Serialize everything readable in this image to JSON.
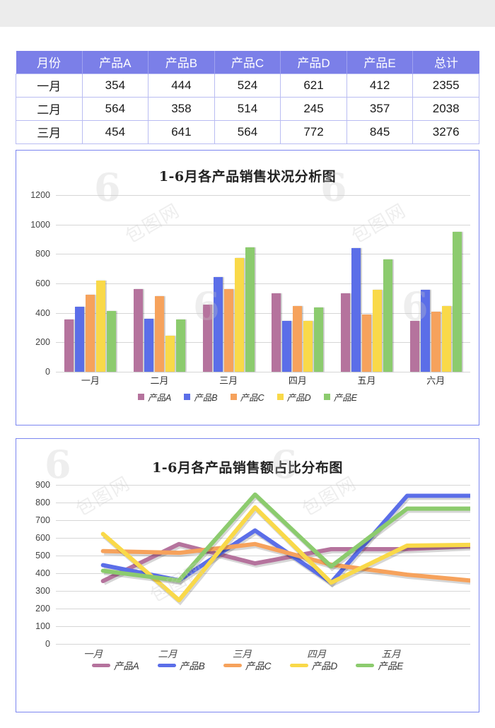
{
  "table": {
    "headers": [
      "月份",
      "产品A",
      "产品B",
      "产品C",
      "产品D",
      "产品E",
      "总计"
    ],
    "rows": [
      {
        "month": "一月",
        "a": "354",
        "b": "444",
        "c": "524",
        "d": "621",
        "e": "412",
        "total": "2355"
      },
      {
        "month": "二月",
        "a": "564",
        "b": "358",
        "c": "514",
        "d": "245",
        "e": "357",
        "total": "2038"
      },
      {
        "month": "三月",
        "a": "454",
        "b": "641",
        "c": "564",
        "d": "772",
        "e": "845",
        "total": "3276"
      }
    ]
  },
  "colors": {
    "product_a": "#b5739d",
    "product_b": "#5b6ee8",
    "product_c": "#f6a25c",
    "product_d": "#f9d949",
    "product_e": "#8ccb6e",
    "header_bg": "#7b7fe8",
    "panel_border": "#7b86f0",
    "gridline": "#d6d6d6"
  },
  "bar_chart": {
    "title": "1-6月各产品销售状况分析图",
    "legend": [
      {
        "label": "产品A",
        "color": "#b5739d"
      },
      {
        "label": "产品B",
        "color": "#5b6ee8"
      },
      {
        "label": "产品C",
        "color": "#f6a25c"
      },
      {
        "label": "产品D",
        "color": "#f9d949"
      },
      {
        "label": "产品E",
        "color": "#8ccb6e"
      }
    ]
  },
  "line_chart": {
    "title": "1-6月各产品销售额占比分布图",
    "legend": [
      {
        "label": "产品A",
        "color": "#b5739d"
      },
      {
        "label": "产品B",
        "color": "#5b6ee8"
      },
      {
        "label": "产品C",
        "color": "#f6a25c"
      },
      {
        "label": "产品D",
        "color": "#f9d949"
      },
      {
        "label": "产品E",
        "color": "#8ccb6e"
      }
    ]
  },
  "chart_data": [
    {
      "type": "bar",
      "title": "1-6月各产品销售状况分析图",
      "xlabel": "",
      "ylabel": "",
      "categories": [
        "一月",
        "二月",
        "三月",
        "四月",
        "五月",
        "六月"
      ],
      "ylim": [
        0,
        1200
      ],
      "yticks": [
        0,
        200,
        400,
        600,
        800,
        1000,
        1200
      ],
      "grid": true,
      "legend_position": "bottom",
      "series": [
        {
          "name": "产品A",
          "color": "#b5739d",
          "values": [
            354,
            564,
            454,
            535,
            535,
            345
          ]
        },
        {
          "name": "产品B",
          "color": "#5b6ee8",
          "values": [
            444,
            358,
            641,
            345,
            838,
            555
          ]
        },
        {
          "name": "产品C",
          "color": "#f6a25c",
          "values": [
            524,
            514,
            564,
            447,
            390,
            410
          ]
        },
        {
          "name": "产品D",
          "color": "#f9d949",
          "values": [
            621,
            245,
            772,
            345,
            555,
            445
          ]
        },
        {
          "name": "产品E",
          "color": "#8ccb6e",
          "values": [
            412,
            357,
            845,
            437,
            765,
            950
          ]
        }
      ]
    },
    {
      "type": "line",
      "title": "1-6月各产品销售额占比分布图",
      "xlabel": "",
      "ylabel": "",
      "categories": [
        "一月",
        "二月",
        "三月",
        "四月",
        "五月"
      ],
      "ylim": [
        0,
        900
      ],
      "yticks": [
        0,
        100,
        200,
        300,
        400,
        500,
        600,
        700,
        800,
        900
      ],
      "grid": true,
      "legend_position": "bottom",
      "series": [
        {
          "name": "产品A",
          "color": "#b5739d",
          "values": [
            354,
            564,
            454,
            535,
            535,
            555
          ]
        },
        {
          "name": "产品B",
          "color": "#5b6ee8",
          "values": [
            444,
            358,
            641,
            345,
            838,
            838
          ]
        },
        {
          "name": "产品C",
          "color": "#f6a25c",
          "values": [
            524,
            514,
            564,
            447,
            390,
            350
          ]
        },
        {
          "name": "产品D",
          "color": "#f9d949",
          "values": [
            621,
            245,
            772,
            345,
            555,
            560
          ]
        },
        {
          "name": "产品E",
          "color": "#8ccb6e",
          "values": [
            412,
            357,
            845,
            437,
            765,
            765
          ]
        }
      ]
    }
  ],
  "watermark": {
    "mark": "6",
    "text": "包图网"
  }
}
